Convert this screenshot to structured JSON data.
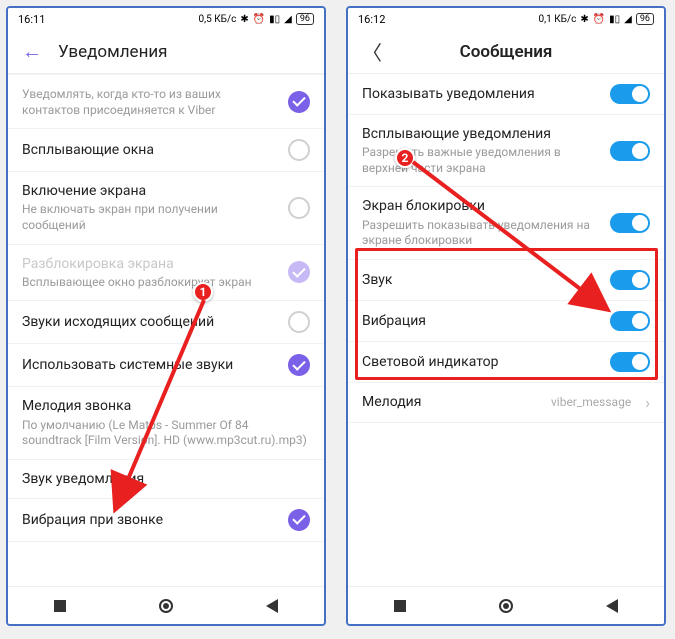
{
  "left": {
    "status": {
      "time": "16:11",
      "net": "0,5 КБ/с",
      "battery": "96"
    },
    "header": {
      "title": "Уведомления"
    },
    "rows": {
      "contact": {
        "sub": "Уведомлять, когда кто-то из ваших контактов присоединяется к Viber"
      },
      "popup": {
        "title": "Всплывающие окна"
      },
      "screen": {
        "title": "Включение экрана",
        "sub": "Не включать экран при получении сообщений"
      },
      "unlock": {
        "title": "Разблокировка экрана",
        "sub": "Всплывающее окно разблокирует экран"
      },
      "outgoing": {
        "title": "Звуки исходящих сообщений"
      },
      "system": {
        "title": "Использовать системные звуки"
      },
      "ringtone": {
        "title": "Мелодия звонка",
        "sub": "По умолчанию (Le Matos - Summer Of 84 soundtrack [Film Version]. HD (www.mp3cut.ru).mp3)"
      },
      "notif_sound": {
        "title": "Звук уведомления"
      },
      "vibration": {
        "title": "Вибрация при звонке"
      }
    }
  },
  "right": {
    "status": {
      "time": "16:12",
      "net": "0,1 КБ/с",
      "battery": "96"
    },
    "header": {
      "title": "Сообщения"
    },
    "rows": {
      "show": {
        "title": "Показывать уведомления"
      },
      "popup": {
        "title": "Всплывающие уведомления",
        "sub": "Разрешить важные уведомления в верхней части экрана"
      },
      "lock": {
        "title": "Экран блокировки",
        "sub": "Разрешить показывать уведомления на экране блокировки"
      },
      "sound": {
        "title": "Звук"
      },
      "vibration": {
        "title": "Вибрация"
      },
      "light": {
        "title": "Световой индикатор"
      },
      "melody": {
        "title": "Мелодия",
        "value": "viber_message"
      }
    }
  },
  "markers": {
    "m1": "1",
    "m2": "2"
  }
}
